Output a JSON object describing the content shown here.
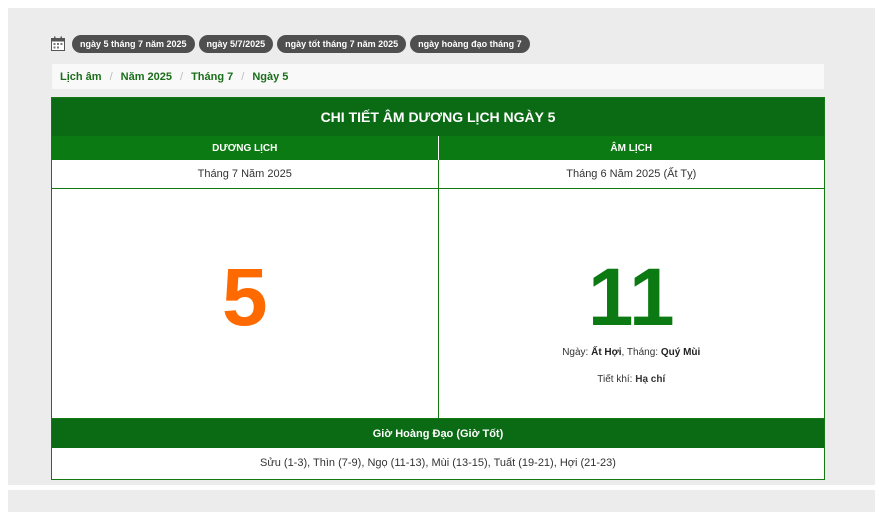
{
  "tags": [
    "ngày 5 tháng 7 năm 2025",
    "ngày 5/7/2025",
    "ngày tốt tháng 7 năm 2025",
    "ngày hoàng đạo tháng 7"
  ],
  "breadcrumb": [
    "Lịch âm",
    "Năm 2025",
    "Tháng 7",
    "Ngày 5"
  ],
  "calendar": {
    "title": "CHI TIẾT ÂM DƯƠNG LỊCH NGÀY 5",
    "solar_header": "DƯƠNG LỊCH",
    "lunar_header": "ÂM LỊCH",
    "solar_month": "Tháng 7 Năm 2025",
    "lunar_month": "Tháng 6 Năm 2025 (Ất Tỵ)",
    "solar_day": "5",
    "lunar_day": "11",
    "day_label": "Ngày: ",
    "day_value": "Ất Hợi",
    "month_label": ", Tháng: ",
    "month_value": "Quý Mùi",
    "term_label": "Tiết khí: ",
    "term_value": "Hạ chí",
    "hours_title": "Giờ Hoàng Đạo (Giờ Tốt)",
    "hours_list": "Sửu (1-3), Thìn (7-9), Ngọ (11-13), Mùi (13-15), Tuất (19-21), Hợi (21-23)"
  },
  "colors": {
    "brand_green": "#0b6b14",
    "solar_orange": "#ff6a00",
    "tag_bg": "#4f4f4f"
  },
  "icons": {
    "calendar": "calendar-icon"
  }
}
